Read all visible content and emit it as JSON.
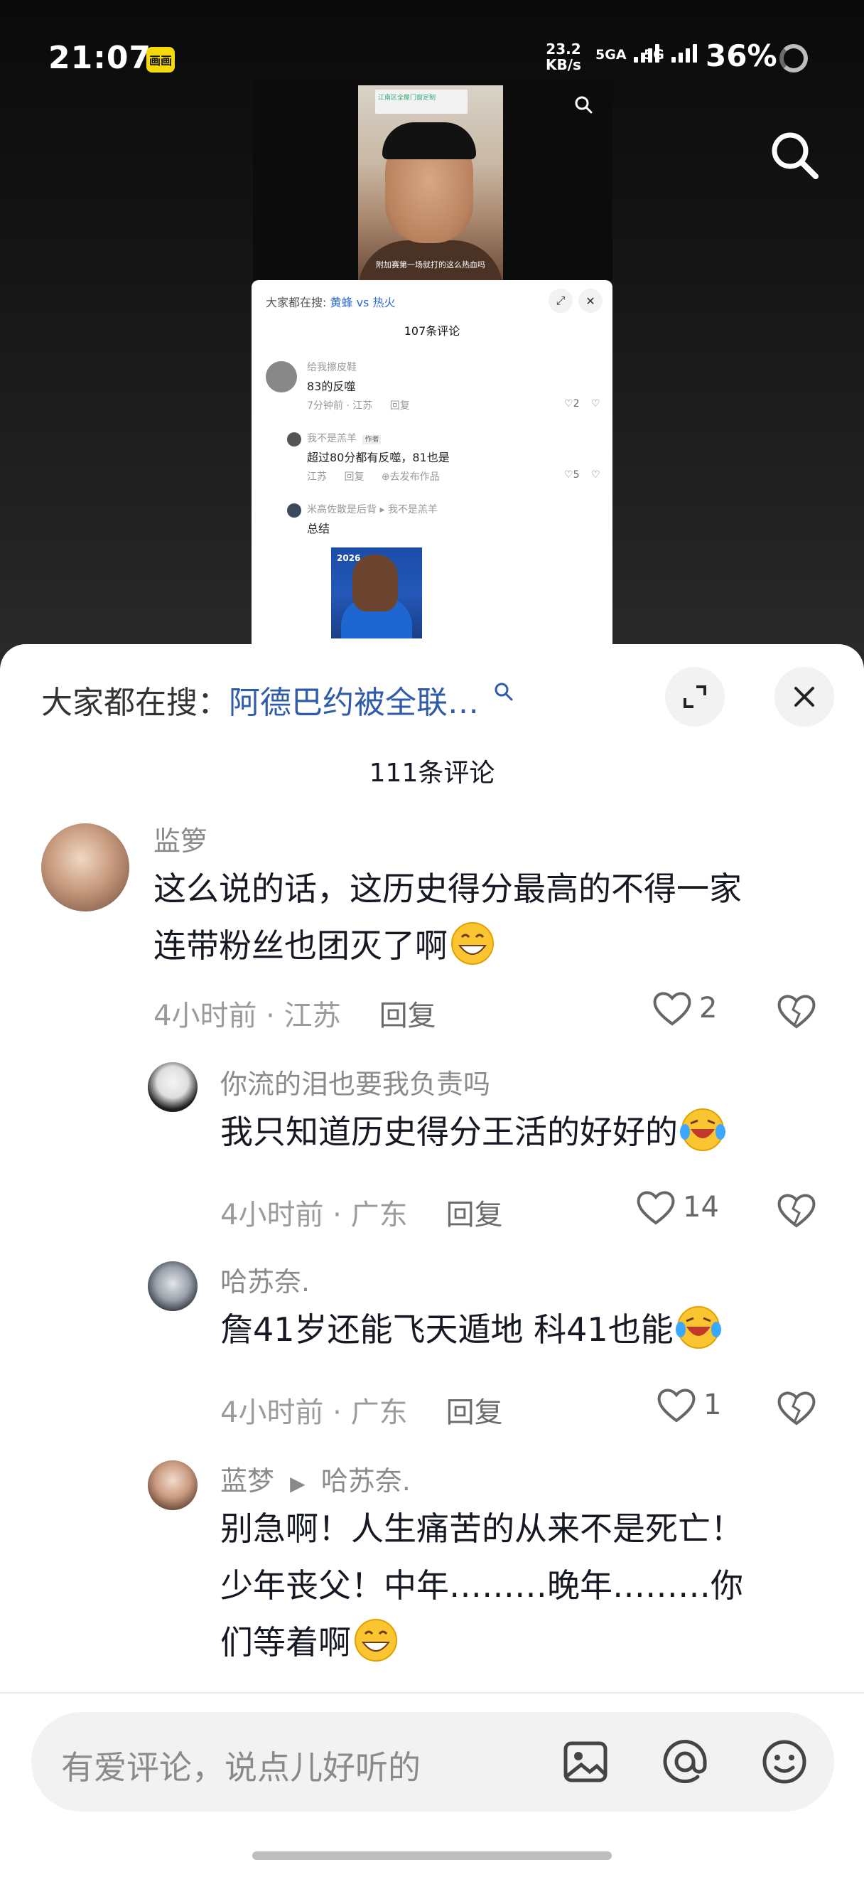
{
  "status_bar": {
    "time": "21:07",
    "app_badge": "画画",
    "net_speed_value": "23.2",
    "net_speed_unit": "KB/s",
    "signal1": "5GA",
    "signal2": "5G",
    "battery": "36%"
  },
  "thumbnail": {
    "video_sign": "江南区全屋门窗定制",
    "video_subtitle": "附加赛第一场就打的这么热血吗",
    "search_prefix": "大家都在搜: ",
    "search_hot": "黄蜂 vs 热火",
    "comment_count": "107条评论",
    "comments": [
      {
        "name": "给我擦皮鞋",
        "text": "83的反噬",
        "meta": "7分钟前 · 江苏",
        "reply": "回复",
        "likes": "2"
      },
      {
        "name": "我不是羔羊",
        "badge": "作者",
        "text": "超过80分都有反噬，81也是",
        "meta": "江苏",
        "reply": "回复",
        "extra": "⊕去发布作品",
        "likes": "5"
      },
      {
        "name": "米高佐散是后背",
        "reply_to": "我不是羔羊",
        "text": "总结"
      }
    ],
    "image_label": "2026"
  },
  "sheet": {
    "search_prefix": "大家都在搜：",
    "search_hot": "阿德巴约被全联…",
    "comment_count": "111条评论",
    "comments": [
      {
        "name": "监箩",
        "line1": "这么说的话，这历史得分最高的不得一家",
        "line2": "连带粉丝也团灭了啊",
        "time_location": "4小时前 · 江苏",
        "reply": "回复",
        "likes": "2"
      },
      {
        "name": "你流的泪也要我负责吗",
        "line1": "我只知道历史得分王活的好好的",
        "time_location": "4小时前 · 广东",
        "reply": "回复",
        "likes": "14"
      },
      {
        "name": "哈苏奈.",
        "line1": "詹41岁还能飞天遁地 科41也能",
        "time_location": "4小时前 · 广东",
        "reply": "回复",
        "likes": "1"
      },
      {
        "name": "蓝梦",
        "reply_to": "哈苏奈.",
        "line1": "别急啊！人生痛苦的从来不是死亡！",
        "line2": "少年丧父！中年………晚年………你",
        "line3": "们等着啊"
      }
    ]
  },
  "input": {
    "placeholder": "有爱评论，说点儿好听的"
  },
  "colors": {
    "accent_blue": "#2f5ba8",
    "sheet_bg": "#ffffff",
    "meta_gray": "#9b9b9b"
  },
  "icons": [
    "search-icon",
    "expand-icon",
    "close-icon",
    "heart-icon",
    "broken-heart-icon",
    "image-icon",
    "at-icon",
    "emoji-icon",
    "grin-emoji",
    "laugh-cry-emoji"
  ]
}
